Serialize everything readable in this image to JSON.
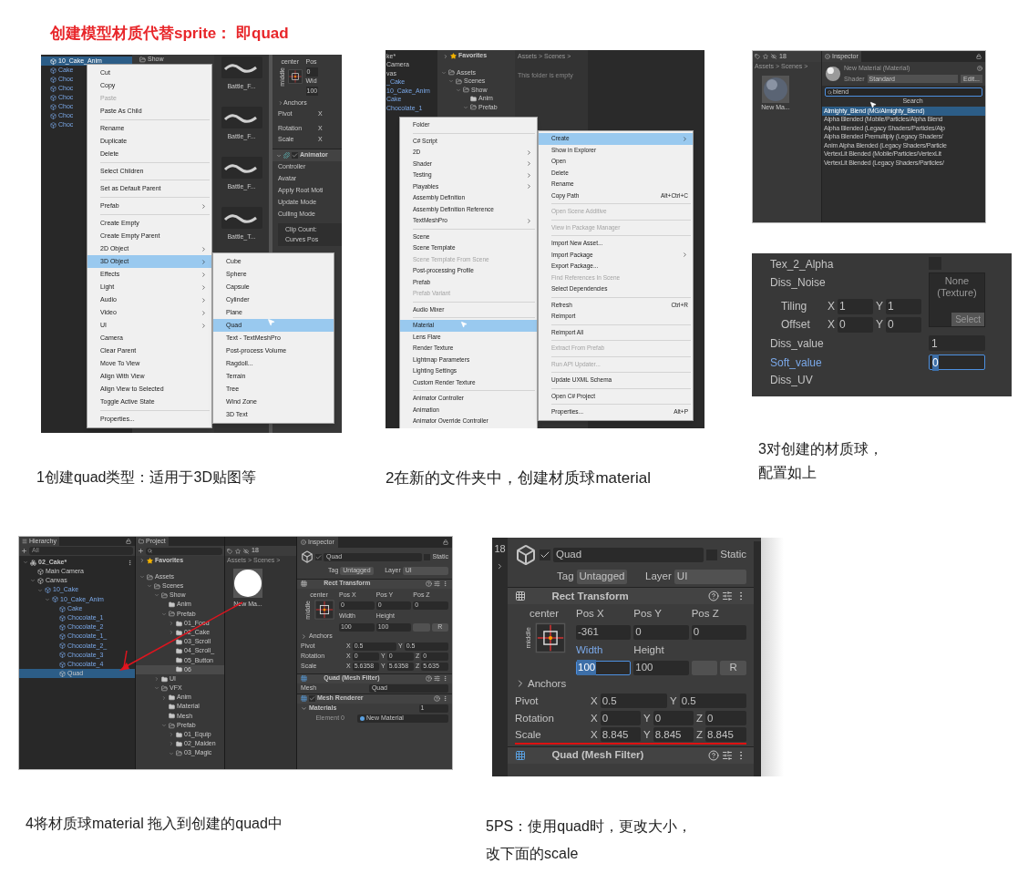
{
  "title": "创建模型材质代替sprite： 即quad",
  "step1": {
    "caption": "1创建quad类型：适用于3D贴图等",
    "hierarchy": [
      {
        "label": "10_Cake_Anim",
        "selected": true
      },
      {
        "label": "Cake",
        "selected": false
      },
      {
        "label": "Choc",
        "selected": false
      },
      {
        "label": "Choc",
        "selected": false
      },
      {
        "label": "Choc",
        "selected": false
      },
      {
        "label": "Choc",
        "selected": false
      },
      {
        "label": "Choc",
        "selected": false
      },
      {
        "label": "Choc",
        "selected": false
      }
    ],
    "project_folder": "Show",
    "thumbnails": [
      "Battle_F...",
      "Battle_F...",
      "Battle_F...",
      "Battle_T..."
    ],
    "inspector": {
      "anchor": "center",
      "side": "middle",
      "pos": "Pos",
      "pos_value": "0",
      "width": "Wid",
      "width_value": "100",
      "anchors": "Anchors",
      "rows": [
        {
          "label": "Pivot",
          "values": [
            {
              "axis": "X"
            }
          ]
        },
        {
          "label": "Rotation",
          "values": [
            {
              "axis": "X"
            }
          ]
        },
        {
          "label": "Scale",
          "values": [
            {
              "axis": "X"
            }
          ]
        }
      ],
      "component": {
        "title": "Animator",
        "enabled": true
      },
      "fields": [
        "Controller",
        "Avatar",
        "Apply Root Moti",
        "Update Mode",
        "Culling Mode"
      ],
      "clip_info": [
        "Clip Count:",
        "Curves Pos"
      ]
    },
    "menu": [
      {
        "kind": "item",
        "label": "Cut",
        "selected": false,
        "disabled": false,
        "submenu": false
      },
      {
        "kind": "item",
        "label": "Copy",
        "selected": false,
        "disabled": false,
        "submenu": false
      },
      {
        "kind": "item",
        "label": "Paste",
        "selected": false,
        "disabled": true,
        "submenu": false
      },
      {
        "kind": "item",
        "label": "Paste As Child",
        "selected": false,
        "disabled": false,
        "submenu": false
      },
      {
        "kind": "separator"
      },
      {
        "kind": "item",
        "label": "Rename",
        "selected": false,
        "disabled": false,
        "submenu": false
      },
      {
        "kind": "item",
        "label": "Duplicate",
        "selected": false,
        "disabled": false,
        "submenu": false
      },
      {
        "kind": "item",
        "label": "Delete",
        "selected": false,
        "disabled": false,
        "submenu": false
      },
      {
        "kind": "separator"
      },
      {
        "kind": "item",
        "label": "Select Children",
        "selected": false,
        "disabled": false,
        "submenu": false
      },
      {
        "kind": "separator"
      },
      {
        "kind": "item",
        "label": "Set as Default Parent",
        "selected": false,
        "disabled": false,
        "submenu": false
      },
      {
        "kind": "separator"
      },
      {
        "kind": "item",
        "label": "Prefab",
        "selected": false,
        "disabled": false,
        "submenu": true
      },
      {
        "kind": "separator"
      },
      {
        "kind": "item",
        "label": "Create Empty",
        "selected": false,
        "disabled": false,
        "submenu": false
      },
      {
        "kind": "item",
        "label": "Create Empty Parent",
        "selected": false,
        "disabled": false,
        "submenu": false
      },
      {
        "kind": "item",
        "label": "2D Object",
        "selected": false,
        "disabled": false,
        "submenu": true
      },
      {
        "kind": "item",
        "label": "3D Object",
        "selected": true,
        "disabled": false,
        "submenu": true
      },
      {
        "kind": "item",
        "label": "Effects",
        "selected": false,
        "disabled": false,
        "submenu": true
      },
      {
        "kind": "item",
        "label": "Light",
        "selected": false,
        "disabled": false,
        "submenu": true
      },
      {
        "kind": "item",
        "label": "Audio",
        "selected": false,
        "disabled": false,
        "submenu": true
      },
      {
        "kind": "item",
        "label": "Video",
        "selected": false,
        "disabled": false,
        "submenu": true
      },
      {
        "kind": "item",
        "label": "UI",
        "selected": false,
        "disabled": false,
        "submenu": true
      },
      {
        "kind": "item",
        "label": "Camera",
        "selected": false,
        "disabled": false,
        "submenu": false
      },
      {
        "kind": "item",
        "label": "Clear Parent",
        "selected": false,
        "disabled": false,
        "submenu": false
      },
      {
        "kind": "item",
        "label": "Move To View",
        "selected": false,
        "disabled": false,
        "submenu": false
      },
      {
        "kind": "item",
        "label": "Align With View",
        "selected": false,
        "disabled": false,
        "submenu": false
      },
      {
        "kind": "item",
        "label": "Align View to Selected",
        "selected": false,
        "disabled": false,
        "submenu": false
      },
      {
        "kind": "item",
        "label": "Toggle Active State",
        "selected": false,
        "disabled": false,
        "submenu": false
      },
      {
        "kind": "separator"
      },
      {
        "kind": "item",
        "label": "Properties...",
        "selected": false,
        "disabled": false,
        "submenu": false
      }
    ],
    "submenu": [
      {
        "kind": "item",
        "label": "Cube",
        "selected": false,
        "disabled": false,
        "submenu": false
      },
      {
        "kind": "item",
        "label": "Sphere",
        "selected": false,
        "disabled": false,
        "submenu": false
      },
      {
        "kind": "item",
        "label": "Capsule",
        "selected": false,
        "disabled": false,
        "submenu": false
      },
      {
        "kind": "item",
        "label": "Cylinder",
        "selected": false,
        "disabled": false,
        "submenu": false
      },
      {
        "kind": "item",
        "label": "Plane",
        "selected": false,
        "disabled": false,
        "submenu": false
      },
      {
        "kind": "item",
        "label": "Quad",
        "selected": true,
        "disabled": false,
        "submenu": false
      },
      {
        "kind": "item",
        "label": "Text - TextMeshPro",
        "selected": false,
        "disabled": false,
        "submenu": false
      },
      {
        "kind": "item",
        "label": "Post-process Volume",
        "selected": false,
        "disabled": false,
        "submenu": false
      },
      {
        "kind": "item",
        "label": "Ragdoll...",
        "selected": false,
        "disabled": false,
        "submenu": false
      },
      {
        "kind": "item",
        "label": "Terrain",
        "selected": false,
        "disabled": false,
        "submenu": false
      },
      {
        "kind": "item",
        "label": "Tree",
        "selected": false,
        "disabled": false,
        "submenu": false
      },
      {
        "kind": "item",
        "label": "Wind Zone",
        "selected": false,
        "disabled": false,
        "submenu": false
      },
      {
        "kind": "item",
        "label": "3D Text",
        "selected": false,
        "disabled": false,
        "submenu": false
      }
    ]
  },
  "step2": {
    "caption": "2在新的文件夹中，创建材质球material",
    "hierarchy": [
      {
        "label": "ke*",
        "selected": false
      },
      {
        "label": "Camera",
        "selected": false
      },
      {
        "label": "vas",
        "selected": false
      },
      {
        "label": "_Cake",
        "selected": false
      },
      {
        "label": "10_Cake_Anim",
        "selected": false
      },
      {
        "label": "Cake",
        "selected": false
      },
      {
        "label": "Chocolate_1",
        "selected": false
      }
    ],
    "favorites": "Favorites",
    "project": [
      {
        "label": "Assets",
        "expanded": true,
        "selected": false,
        "children": [
          {
            "label": "Scenes",
            "expanded": true,
            "selected": false,
            "children": [
              {
                "label": "Show",
                "expanded": true,
                "selected": false,
                "children": [
                  {
                    "label": "Anim",
                    "selected": false
                  },
                  {
                    "label": "Prefab",
                    "expanded": true,
                    "selected": false
                  }
                ]
              }
            ]
          }
        ]
      }
    ],
    "breadcrumb": "Assets > Scenes >",
    "empty_note": "This folder is empty",
    "menu": [
      {
        "kind": "item",
        "label": "Folder",
        "selected": false,
        "disabled": false,
        "submenu": false
      },
      {
        "kind": "separator"
      },
      {
        "kind": "item",
        "label": "C# Script",
        "selected": false,
        "disabled": false,
        "submenu": false
      },
      {
        "kind": "item",
        "label": "2D",
        "selected": false,
        "disabled": false,
        "submenu": true
      },
      {
        "kind": "item",
        "label": "Shader",
        "selected": false,
        "disabled": false,
        "submenu": true
      },
      {
        "kind": "item",
        "label": "Testing",
        "selected": false,
        "disabled": false,
        "submenu": true
      },
      {
        "kind": "item",
        "label": "Playables",
        "selected": false,
        "disabled": false,
        "submenu": true
      },
      {
        "kind": "item",
        "label": "Assembly Definition",
        "selected": false,
        "disabled": false,
        "submenu": false
      },
      {
        "kind": "item",
        "label": "Assembly Definition Reference",
        "selected": false,
        "disabled": false,
        "submenu": false
      },
      {
        "kind": "item",
        "label": "TextMeshPro",
        "selected": false,
        "disabled": false,
        "submenu": true
      },
      {
        "kind": "separator"
      },
      {
        "kind": "item",
        "label": "Scene",
        "selected": false,
        "disabled": false,
        "submenu": false
      },
      {
        "kind": "item",
        "label": "Scene Template",
        "selected": false,
        "disabled": false,
        "submenu": false
      },
      {
        "kind": "item",
        "label": "Scene Template From Scene",
        "selected": false,
        "disabled": true,
        "submenu": false
      },
      {
        "kind": "item",
        "label": "Post-processing Profile",
        "selected": false,
        "disabled": false,
        "submenu": false
      },
      {
        "kind": "item",
        "label": "Prefab",
        "selected": false,
        "disabled": false,
        "submenu": false
      },
      {
        "kind": "item",
        "label": "Prefab Variant",
        "selected": false,
        "disabled": true,
        "submenu": false
      },
      {
        "kind": "separator"
      },
      {
        "kind": "item",
        "label": "Audio Mixer",
        "selected": false,
        "disabled": false,
        "submenu": false
      },
      {
        "kind": "separator"
      },
      {
        "kind": "item",
        "label": "Material",
        "selected": true,
        "disabled": false,
        "submenu": false
      },
      {
        "kind": "item",
        "label": "Lens Flare",
        "selected": false,
        "disabled": false,
        "submenu": false
      },
      {
        "kind": "item",
        "label": "Render Texture",
        "selected": false,
        "disabled": false,
        "submenu": false
      },
      {
        "kind": "item",
        "label": "Lightmap Parameters",
        "selected": false,
        "disabled": false,
        "submenu": false
      },
      {
        "kind": "item",
        "label": "Lighting Settings",
        "selected": false,
        "disabled": false,
        "submenu": false
      },
      {
        "kind": "item",
        "label": "Custom Render Texture",
        "selected": false,
        "disabled": false,
        "submenu": false
      },
      {
        "kind": "separator"
      },
      {
        "kind": "item",
        "label": "Animator Controller",
        "selected": false,
        "disabled": false,
        "submenu": false
      },
      {
        "kind": "item",
        "label": "Animation",
        "selected": false,
        "disabled": false,
        "submenu": false
      },
      {
        "kind": "item",
        "label": "Animator Override Controller",
        "selected": false,
        "disabled": false,
        "submenu": false
      }
    ],
    "context_menu": [
      {
        "kind": "item",
        "label": "Create",
        "selected": true,
        "disabled": false,
        "submenu": true
      },
      {
        "kind": "item",
        "label": "Show in Explorer",
        "selected": false,
        "disabled": false,
        "submenu": false
      },
      {
        "kind": "item",
        "label": "Open",
        "selected": false,
        "disabled": false,
        "submenu": false
      },
      {
        "kind": "item",
        "label": "Delete",
        "selected": false,
        "disabled": false,
        "submenu": false
      },
      {
        "kind": "item",
        "label": "Rename",
        "selected": false,
        "disabled": false,
        "submenu": false
      },
      {
        "kind": "item",
        "label": "Copy Path",
        "shortcut": "Alt+Ctrl+C",
        "selected": false,
        "disabled": false,
        "submenu": false
      },
      {
        "kind": "separator"
      },
      {
        "kind": "item",
        "label": "Open Scene Additive",
        "selected": false,
        "disabled": true,
        "submenu": false
      },
      {
        "kind": "separator"
      },
      {
        "kind": "item",
        "label": "View in Package Manager",
        "selected": false,
        "disabled": true,
        "submenu": false
      },
      {
        "kind": "separator"
      },
      {
        "kind": "item",
        "label": "Import New Asset...",
        "selected": false,
        "disabled": false,
        "submenu": false
      },
      {
        "kind": "item",
        "label": "Import Package",
        "selected": false,
        "disabled": false,
        "submenu": true
      },
      {
        "kind": "item",
        "label": "Export Package...",
        "selected": false,
        "disabled": false,
        "submenu": false
      },
      {
        "kind": "item",
        "label": "Find References In Scene",
        "selected": false,
        "disabled": true,
        "submenu": false
      },
      {
        "kind": "item",
        "label": "Select Dependencies",
        "selected": false,
        "disabled": false,
        "submenu": false
      },
      {
        "kind": "separator"
      },
      {
        "kind": "item",
        "label": "Refresh",
        "shortcut": "Ctrl+R",
        "selected": false,
        "disabled": false,
        "submenu": false
      },
      {
        "kind": "item",
        "label": "Reimport",
        "selected": false,
        "disabled": false,
        "submenu": false
      },
      {
        "kind": "separator"
      },
      {
        "kind": "item",
        "label": "Reimport All",
        "selected": false,
        "disabled": false,
        "submenu": false
      },
      {
        "kind": "separator"
      },
      {
        "kind": "item",
        "label": "Extract From Prefab",
        "selected": false,
        "disabled": true,
        "submenu": false
      },
      {
        "kind": "separator"
      },
      {
        "kind": "item",
        "label": "Run API Updater...",
        "selected": false,
        "disabled": true,
        "submenu": false
      },
      {
        "kind": "separator"
      },
      {
        "kind": "item",
        "label": "Update UXML Schema",
        "selected": false,
        "disabled": false,
        "submenu": false
      },
      {
        "kind": "separator"
      },
      {
        "kind": "item",
        "label": "Open C# Project",
        "selected": false,
        "disabled": false,
        "submenu": false
      },
      {
        "kind": "separator"
      },
      {
        "kind": "item",
        "label": "Properties...",
        "shortcut": "Alt+P",
        "selected": false,
        "disabled": false,
        "submenu": false
      }
    ]
  },
  "step3": {
    "caption": [
      "3对创建的材质球，",
      "配置如上"
    ],
    "count": "18",
    "breadcrumb": "Assets > Scenes >",
    "asset": "New Ma...",
    "tab": "Inspector",
    "material": "New Material (Material)",
    "shader_label": "Shader",
    "shader": "Standard",
    "edit": "Edit...",
    "search": "blend",
    "results_title": "Search",
    "results": [
      {
        "label": "Almighty_Blend (MG/Almighty_Blend)",
        "selected": true
      },
      {
        "label": "Alpha Blended (Mobile/Particles/Alpha Blend",
        "selected": false
      },
      {
        "label": "Alpha Blended (Legacy Shaders/Particles/Alp",
        "selected": false
      },
      {
        "label": "Alpha Blended Premultiply (Legacy Shaders/",
        "selected": false
      },
      {
        "label": "Anim Alpha Blended (Legacy Shaders/Particle",
        "selected": false
      },
      {
        "label": "VertexLit Blended (Mobile/Particles/VertexLit",
        "selected": false
      },
      {
        "label": "VertexLit Blended (Legacy Shaders/Particles/",
        "selected": false
      }
    ],
    "props": {
      "alpha": {
        "label": "Tex_2_Alpha",
        "checked": false
      },
      "noise": "Diss_Noise",
      "texture": [
        "None",
        "(Texture)"
      ],
      "select": "Select",
      "vectors": [
        {
          "label": "Tiling",
          "values": [
            {
              "axis": "X",
              "value": "1"
            },
            {
              "axis": "Y",
              "value": "1"
            }
          ]
        },
        {
          "label": "Offset",
          "values": [
            {
              "axis": "X",
              "value": "0"
            },
            {
              "axis": "Y",
              "value": "0"
            }
          ]
        }
      ],
      "values": [
        {
          "label": "Diss_value",
          "value": "1",
          "focused": false
        },
        {
          "label": "Soft_value",
          "value": "0",
          "focused": true
        }
      ],
      "uv": "Diss_UV"
    }
  },
  "step4": {
    "caption": "4将材质球material 拖入到创建的quad中",
    "hierarchy_tab": "Hierarchy",
    "hierarchy_search": {
      "placeholder": "All"
    },
    "hierarchy": [
      {
        "label": "02_Cake*",
        "expanded": true,
        "selected": false,
        "prefab": false,
        "children": [
          {
            "label": "Main Camera",
            "selected": false,
            "prefab": false
          },
          {
            "label": "Canvas",
            "expanded": true,
            "selected": false,
            "prefab": false,
            "children": [
              {
                "label": "10_Cake",
                "expanded": true,
                "selected": false,
                "prefab": true,
                "children": [
                  {
                    "label": "10_Cake_Anim",
                    "expanded": true,
                    "selected": false,
                    "prefab": true,
                    "children": [
                      {
                        "label": "Cake",
                        "selected": false,
                        "prefab": true
                      },
                      {
                        "label": "Chocolate_1",
                        "selected": false,
                        "prefab": true
                      },
                      {
                        "label": "Chocolate_2",
                        "selected": false,
                        "prefab": true
                      },
                      {
                        "label": "Chocolate_1_",
                        "selected": false,
                        "prefab": true
                      },
                      {
                        "label": "Chocolate_2_",
                        "selected": false,
                        "prefab": true
                      },
                      {
                        "label": "Chocolate_3",
                        "selected": false,
                        "prefab": true
                      },
                      {
                        "label": "Chocolate_4",
                        "selected": false,
                        "prefab": true
                      },
                      {
                        "label": "Quad",
                        "selected": true,
                        "prefab": false
                      }
                    ]
                  }
                ]
              }
            ]
          }
        ]
      }
    ],
    "project_tab": "Project",
    "favorites": "Favorites",
    "count": "18",
    "breadcrumb": "Assets > Scenes >",
    "asset": "New Ma...",
    "project": [
      {
        "label": "Assets",
        "expanded": true,
        "selected": false,
        "children": [
          {
            "label": "Scenes",
            "expanded": true,
            "selected": false,
            "children": [
              {
                "label": "Show",
                "expanded": true,
                "selected": false,
                "children": [
                  {
                    "label": "Anim",
                    "selected": false
                  },
                  {
                    "label": "Prefab",
                    "expanded": true,
                    "selected": false,
                    "children": [
                      {
                        "label": "01_Food",
                        "expanded": false,
                        "selected": false
                      },
                      {
                        "label": "02_Cake",
                        "expanded": false,
                        "selected": false
                      },
                      {
                        "label": "03_Scroll",
                        "selected": false
                      },
                      {
                        "label": "04_Scroll_",
                        "selected": false
                      },
                      {
                        "label": "05_Button",
                        "selected": false
                      },
                      {
                        "label": "06",
                        "selected": true
                      }
                    ]
                  }
                ]
              },
              {
                "label": "UI",
                "expanded": false,
                "selected": false
              },
              {
                "label": "VFX",
                "expanded": true,
                "selected": false,
                "children": [
                  {
                    "label": "Anim",
                    "expanded": false,
                    "selected": false
                  },
                  {
                    "label": "Material",
                    "selected": false
                  },
                  {
                    "label": "Mesh",
                    "selected": false
                  },
                  {
                    "label": "Prefab",
                    "expanded": true,
                    "selected": false,
                    "children": [
                      {
                        "label": "01_Equip",
                        "expanded": false,
                        "selected": false
                      },
                      {
                        "label": "02_Maiden",
                        "expanded": false,
                        "selected": false
                      },
                      {
                        "label": "03_Magic",
                        "expanded": true,
                        "selected": false
                      }
                    ]
                  }
                ]
              }
            ]
          }
        ]
      }
    ],
    "inspector": {
      "tab": "Inspector",
      "name": "Quad",
      "active": true,
      "static_label": "Static",
      "static": false,
      "tag_label": "Tag",
      "tag": "Untagged",
      "layer_label": "Layer",
      "layer": "UI",
      "transform": {
        "title": "Rect Transform",
        "anchor": "center",
        "side": "middle",
        "position": [
          {
            "label": "Pos X",
            "value": "0"
          },
          {
            "label": "Pos Y",
            "value": "0"
          },
          {
            "label": "Pos Z",
            "value": "0"
          }
        ],
        "size": [
          {
            "label": "Width",
            "value": "100",
            "focused": false
          },
          {
            "label": "Height",
            "value": "100",
            "focused": false
          }
        ],
        "reset": "R",
        "anchors": "Anchors",
        "rows": [
          {
            "label": "Pivot",
            "underlined": false,
            "values": [
              {
                "axis": "X",
                "value": "0.5"
              },
              {
                "axis": "Y",
                "value": "0.5"
              }
            ]
          },
          {
            "label": "Rotation",
            "underlined": false,
            "values": [
              {
                "axis": "X",
                "value": "0"
              },
              {
                "axis": "Y",
                "value": "0"
              },
              {
                "axis": "Z",
                "value": "0"
              }
            ]
          },
          {
            "label": "Scale",
            "underlined": false,
            "values": [
              {
                "axis": "X",
                "value": "5.6358"
              },
              {
                "axis": "Y",
                "value": "5.6358"
              },
              {
                "axis": "Z",
                "value": "5.635"
              }
            ]
          }
        ]
      },
      "components": [
        {
          "kind": "mesh_filter",
          "title": "Quad (Mesh Filter)",
          "mesh_label": "Mesh",
          "mesh": "Quad"
        },
        {
          "kind": "mesh_renderer",
          "title": "Mesh Renderer",
          "enabled": true,
          "materials_label": "Materials",
          "materials_count": "1",
          "element_label": "Element 0",
          "material": "New Material"
        }
      ]
    }
  },
  "step5": {
    "caption": [
      "5PS：使用quad时，更改大小，",
      "改下面的scale"
    ],
    "count": "18",
    "inspector": {
      "name": "Quad",
      "active": true,
      "static_label": "Static",
      "static": false,
      "tag_label": "Tag",
      "tag": "Untagged",
      "layer_label": "Layer",
      "layer": "UI",
      "transform": {
        "title": "Rect Transform",
        "anchor": "center",
        "side": "middle",
        "position": [
          {
            "label": "Pos X",
            "value": "-361"
          },
          {
            "label": "Pos Y",
            "value": "0"
          },
          {
            "label": "Pos Z",
            "value": "0"
          }
        ],
        "size": [
          {
            "label": "Width",
            "value": "100",
            "focused": true
          },
          {
            "label": "Height",
            "value": "100",
            "focused": false
          }
        ],
        "reset": "R",
        "anchors": "Anchors",
        "rows": [
          {
            "label": "Pivot",
            "underlined": false,
            "values": [
              {
                "axis": "X",
                "value": "0.5"
              },
              {
                "axis": "Y",
                "value": "0.5"
              }
            ]
          },
          {
            "label": "Rotation",
            "underlined": false,
            "values": [
              {
                "axis": "X",
                "value": "0"
              },
              {
                "axis": "Y",
                "value": "0"
              },
              {
                "axis": "Z",
                "value": "0"
              }
            ]
          },
          {
            "label": "Scale",
            "underlined": true,
            "values": [
              {
                "axis": "X",
                "value": "8.845"
              },
              {
                "axis": "Y",
                "value": "8.845"
              },
              {
                "axis": "Z",
                "value": "8.845"
              }
            ]
          }
        ]
      },
      "components": [
        {
          "kind": "mesh_filter",
          "title": "Quad (Mesh Filter)"
        }
      ]
    }
  }
}
